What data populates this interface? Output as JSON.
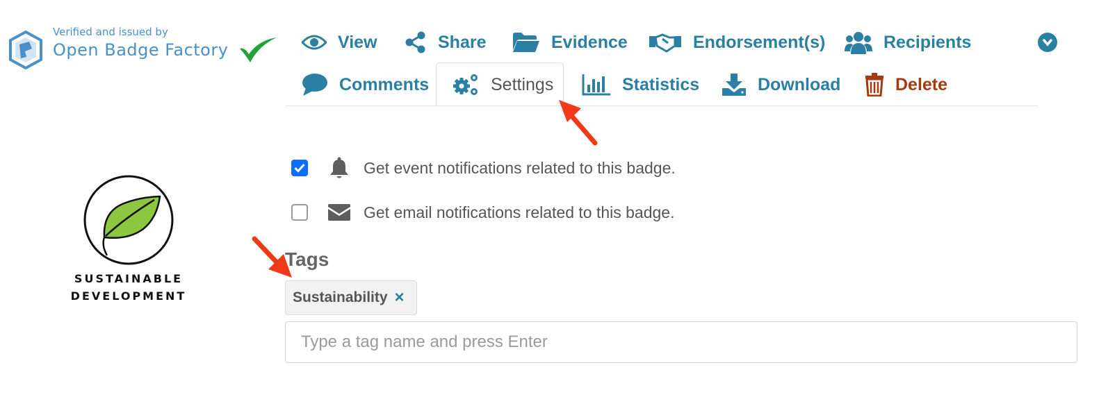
{
  "issuer": {
    "verified_text": "Verified and issued by",
    "name": "Open Badge Factory",
    "brand_color": "#4a90c8"
  },
  "badge": {
    "line1": "SUSTAINABLE",
    "line2": "DEVELOPMENT",
    "leaf_color": "#8dc63f"
  },
  "nav": {
    "row1": [
      {
        "label": "View",
        "icon": "eye-icon"
      },
      {
        "label": "Share",
        "icon": "share-icon"
      },
      {
        "label": "Evidence",
        "icon": "folder-open-icon"
      },
      {
        "label": "Endorsement(s)",
        "icon": "handshake-icon"
      },
      {
        "label": "Recipients",
        "icon": "users-icon"
      }
    ],
    "row2": [
      {
        "label": "Comments",
        "icon": "comment-icon"
      },
      {
        "label": "Settings",
        "icon": "cogs-icon",
        "active": true
      },
      {
        "label": "Statistics",
        "icon": "bar-chart-icon"
      },
      {
        "label": "Download",
        "icon": "download-icon"
      },
      {
        "label": "Delete",
        "icon": "trash-icon"
      }
    ],
    "more_icon": "chevron-down-circle-icon",
    "link_color": "#2a7fa3",
    "delete_color": "#a63a0c"
  },
  "settings": {
    "event_notifications": {
      "label": "Get event notifications related to this badge.",
      "checked": true,
      "icon": "bell-icon"
    },
    "email_notifications": {
      "label": "Get email notifications related to this badge.",
      "checked": false,
      "icon": "envelope-icon"
    }
  },
  "tags": {
    "heading": "Tags",
    "items": [
      {
        "label": "Sustainability",
        "remove": "×"
      }
    ],
    "input_placeholder": "Type a tag name and press Enter",
    "input_value": ""
  },
  "annotation_color": "#f03a17"
}
